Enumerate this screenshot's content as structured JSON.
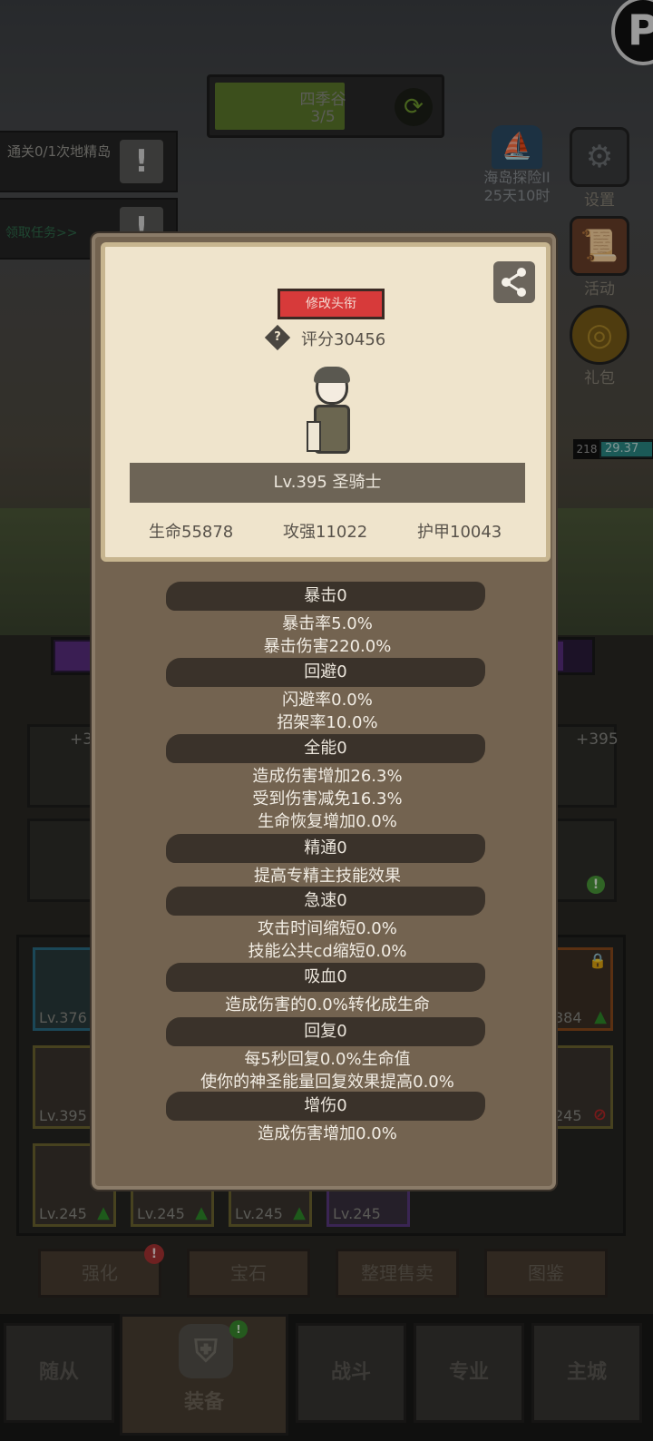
{
  "background": {
    "progress": {
      "title": "四季谷",
      "count": "3/5",
      "fraction": 0.6
    },
    "quests": [
      {
        "text": "通关0/1次地精岛"
      },
      {
        "text": ""
      }
    ],
    "accept_task_link": "领取任务>>",
    "corner_badge": "P",
    "right_icons": {
      "explore": {
        "label": "海岛探险II",
        "timer": "25天10时"
      },
      "settings": "设置",
      "events": "活动",
      "gift": "礼包"
    },
    "enemy": {
      "level": "218",
      "hp": "29.37"
    },
    "equipment": {
      "lower_left_plus": "+3",
      "lower_right_plus": "+395",
      "rows": [
        {
          "left_level": "Lv.376",
          "right_level": "384"
        },
        {
          "left_level": "Lv.395",
          "right_level": "245"
        },
        {
          "levels": [
            "Lv.245",
            "Lv.245",
            "Lv.245",
            "Lv.245"
          ]
        }
      ]
    },
    "action_buttons": [
      "强化",
      "宝石",
      "整理售卖",
      "图鉴"
    ],
    "bottom_nav": [
      "随从",
      "装备",
      "战斗",
      "专业",
      "主城"
    ]
  },
  "modal": {
    "title_button": "修改头衔",
    "score": "评分30456",
    "level_class": "Lv.395 圣骑士",
    "base_stats": {
      "hp": "生命55878",
      "attack": "攻强11022",
      "armor": "护甲10043"
    },
    "sections": [
      {
        "header": "暴击0",
        "lines": [
          "暴击率5.0%",
          "暴击伤害220.0%"
        ]
      },
      {
        "header": "回避0",
        "lines": [
          "闪避率0.0%",
          "招架率10.0%"
        ]
      },
      {
        "header": "全能0",
        "lines": [
          "造成伤害增加26.3%",
          "受到伤害减免16.3%",
          "生命恢复增加0.0%"
        ]
      },
      {
        "header": "精通0",
        "lines": [
          "提高专精主技能效果"
        ]
      },
      {
        "header": "急速0",
        "lines": [
          "攻击时间缩短0.0%",
          "技能公共cd缩短0.0%"
        ]
      },
      {
        "header": "吸血0",
        "lines": [
          "造成伤害的0.0%转化成生命"
        ]
      },
      {
        "header": "回复0",
        "lines": [
          "每5秒回复0.0%生命值",
          "使你的神圣能量回复效果提高0.0%"
        ]
      },
      {
        "header": "增伤0",
        "lines": [
          "造成伤害增加0.0%"
        ]
      }
    ]
  }
}
